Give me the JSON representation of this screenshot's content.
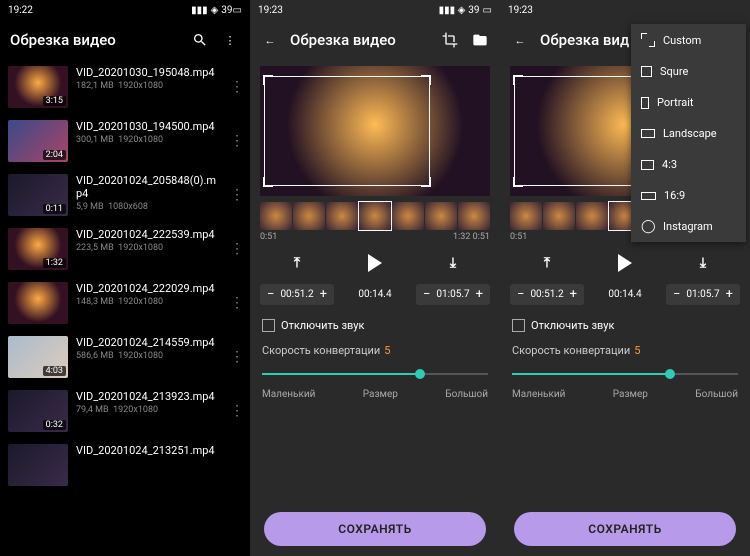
{
  "status": {
    "time1": "19:22",
    "time2": "19:23",
    "time3": "19:23",
    "battery": "39"
  },
  "list": {
    "title": "Обрезка видео",
    "items": [
      {
        "name": "VID_20201030_195048.mp4",
        "size": "182,1 MB",
        "res": "1920x1080",
        "dur": "3:15"
      },
      {
        "name": "VID_20201030_194500.mp4",
        "size": "300,1 MB",
        "res": "1920x1080",
        "dur": "2:04"
      },
      {
        "name": "VID_20201024_205848(0).mp4",
        "size": "5,9 MB",
        "res": "1080x608",
        "dur": "0:11"
      },
      {
        "name": "VID_20201024_222539.mp4",
        "size": "223,5 MB",
        "res": "1920x1080",
        "dur": "1:32"
      },
      {
        "name": "VID_20201024_222029.mp4",
        "size": "148,3 MB",
        "res": "1920x1080",
        "dur": ""
      },
      {
        "name": "VID_20201024_214559.mp4",
        "size": "586,6 MB",
        "res": "1920x1080",
        "dur": "4:03"
      },
      {
        "name": "VID_20201024_213923.mp4",
        "size": "79,4 MB",
        "res": "1920x1080",
        "dur": "0:32"
      },
      {
        "name": "VID_20201024_213251.mp4",
        "size": "",
        "res": "",
        "dur": ""
      }
    ]
  },
  "editor": {
    "title": "Обрезка видео",
    "title_trunc": "Обрезка вид",
    "time_start": "0:51",
    "time_end": "1:32",
    "time_total": "0:51",
    "left_val": "00:51.2",
    "mid_val": "00:14.4",
    "right_val": "01:05.7",
    "mute_label": "Отключить звук",
    "speed_label": "Скорость конвертации",
    "speed_val": "5",
    "size_small": "Маленький",
    "size_mid": "Размер",
    "size_big": "Большой",
    "save": "СОХРАНЯТЬ"
  },
  "aspect_menu": {
    "items": [
      "Custom",
      "Squre",
      "Portrait",
      "Landscape",
      "4:3",
      "16:9",
      "Instagram"
    ]
  }
}
